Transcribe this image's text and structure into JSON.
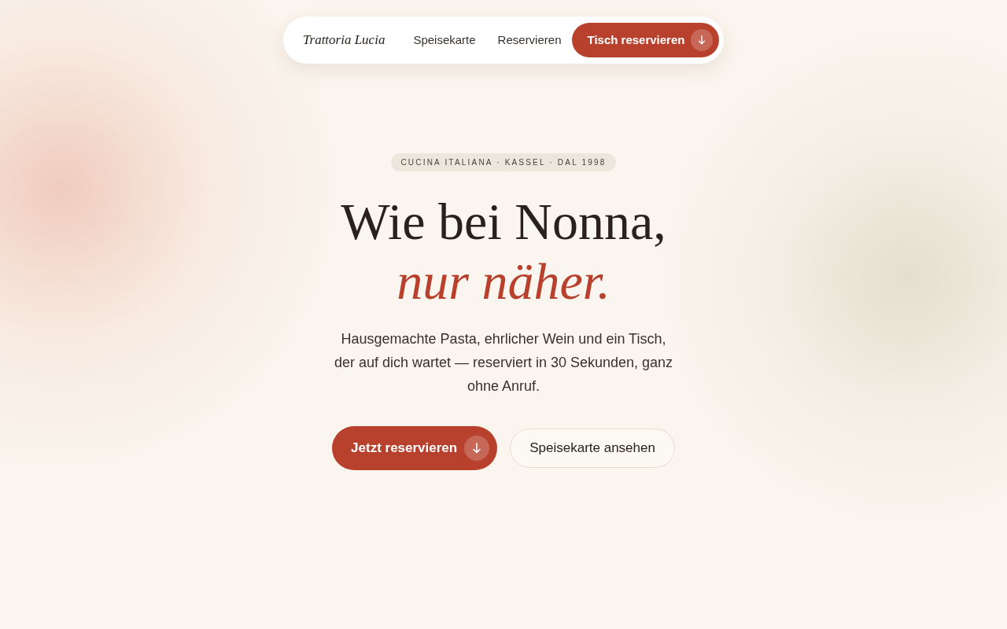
{
  "nav": {
    "logo": "Trattoria Lucia",
    "links": [
      {
        "label": "Speisekarte"
      },
      {
        "label": "Reservieren"
      }
    ],
    "cta": {
      "label": "Tisch reservieren",
      "kind": "primary"
    }
  },
  "hero": {
    "badge": "CUCINA ITALIANA · KASSEL · DAL 1998",
    "headline": "Wie bei Nonna,",
    "headline_accent": "nur näher.",
    "lede": "Hausgemachte Pasta, ehrlicher Wein und ein Tisch, der auf dich wartet — reserviert in 30 Sekunden, ganz ohne Anruf.",
    "buttons": [
      {
        "label": "Jetzt reservieren",
        "kind": "primary"
      },
      {
        "label": "Speisekarte ansehen",
        "kind": "secondary"
      }
    ]
  }
}
